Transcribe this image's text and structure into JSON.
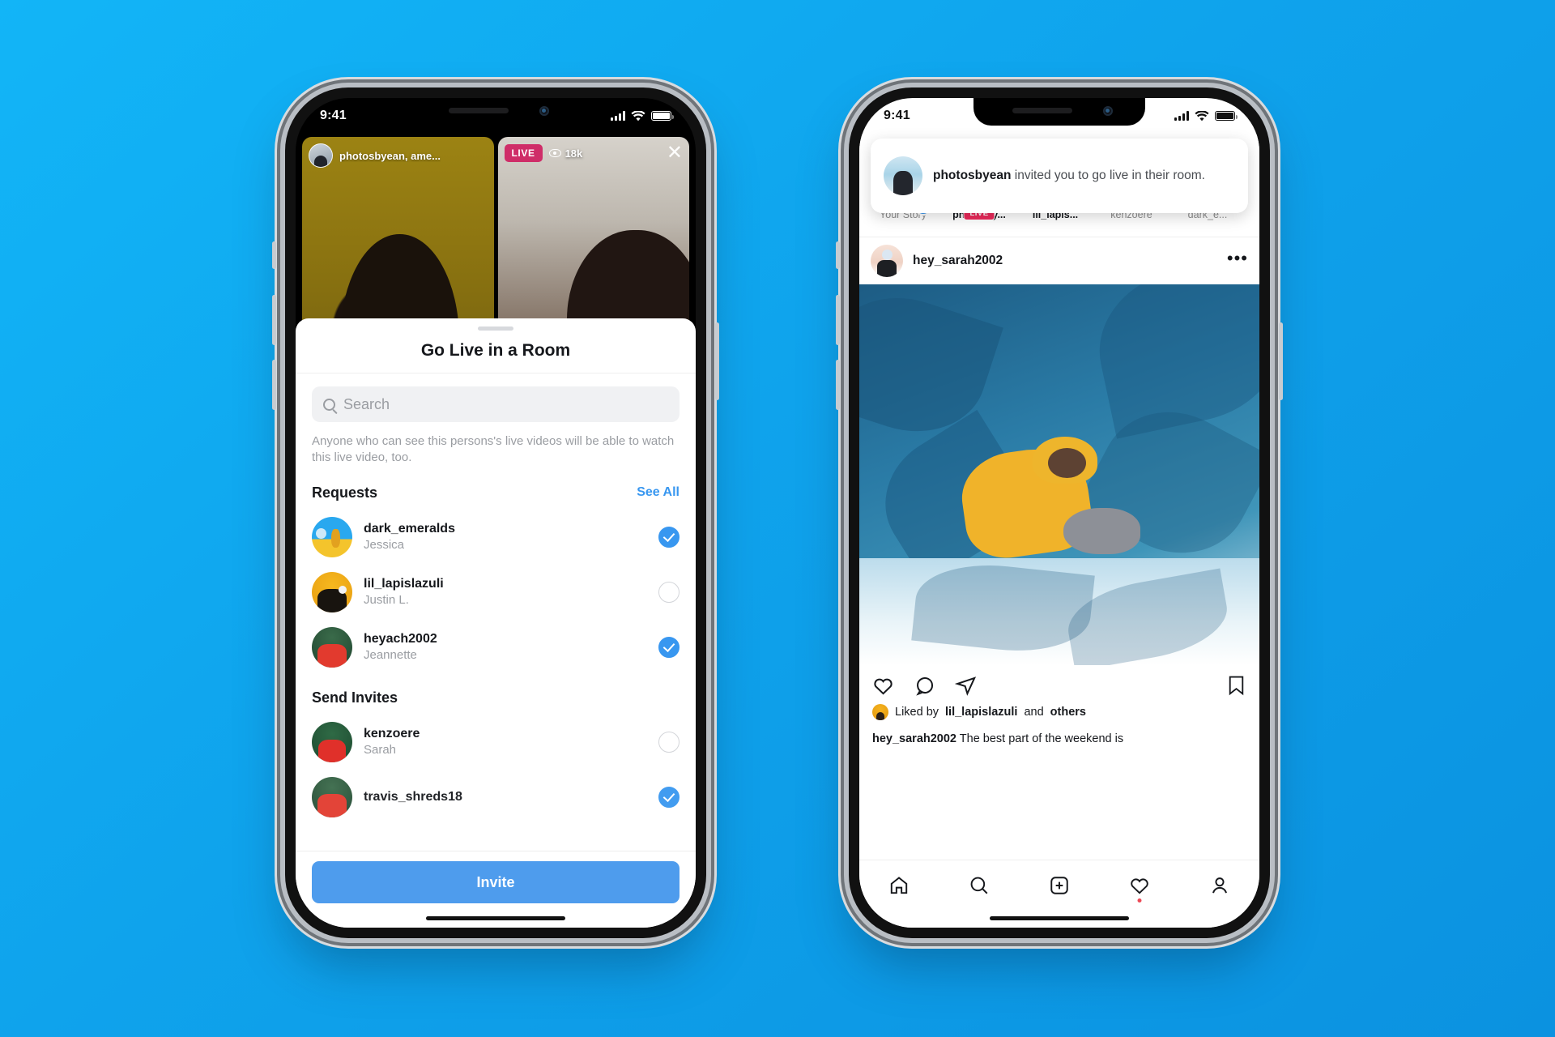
{
  "theme": {
    "background": "#0fa9f0",
    "accent": "#3897f0",
    "live_red": "#ed2a5b",
    "cta_blue": "#4e9ced"
  },
  "phone1": {
    "status_bar": {
      "time": "9:41"
    },
    "live_grid": {
      "tile_left": {
        "names": "photosbyean, ame..."
      },
      "tile_right": {
        "live_label": "LIVE",
        "viewers": "18k",
        "close_label": "✕"
      }
    },
    "sheet": {
      "title": "Go Live in a Room",
      "search_placeholder": "Search",
      "helper_text": "Anyone who can see this persons's live videos will be able to watch this live video, too.",
      "sections": [
        {
          "title": "Requests",
          "action_label": "See All",
          "people": [
            {
              "username": "dark_emeralds",
              "name": "Jessica",
              "selected": true,
              "avatar": "illustration-avatar"
            },
            {
              "username": "lil_lapislazuli",
              "name": "Justin L.",
              "selected": false,
              "avatar": "yellow-avatar"
            },
            {
              "username": "heyach2002",
              "name": "Jeannette",
              "selected": true,
              "avatar": "red-avatar"
            }
          ]
        },
        {
          "title": "Send Invites",
          "action_label": "",
          "people": [
            {
              "username": "kenzoere",
              "name": "Sarah",
              "selected": false,
              "avatar": "green-avatar"
            },
            {
              "username": "travis_shreds18",
              "name": "",
              "selected": true,
              "avatar": "red-avatar"
            }
          ]
        }
      ],
      "cta_label": "Invite"
    }
  },
  "phone2": {
    "status_bar": {
      "time": "9:41"
    },
    "notification": {
      "actor": "photosbyean",
      "message": " invited you to go live in their room."
    },
    "stories": [
      {
        "label": "Your Story",
        "ring": "none",
        "badge": "plus",
        "avatar": "dark-avatar"
      },
      {
        "label": "photosby...",
        "ring": "grad",
        "badge": "live",
        "live_label": "LIVE",
        "avatar": "beach-avatar"
      },
      {
        "label": "lil_lapis...",
        "ring": "grad",
        "badge": "",
        "avatar": "yellow-avatar"
      },
      {
        "label": "kenzoere",
        "ring": "plain",
        "badge": "",
        "avatar": "green-avatar"
      },
      {
        "label": "dark_e...",
        "ring": "plain",
        "badge": "",
        "avatar": "illustration-avatar"
      }
    ],
    "post": {
      "username": "hey_sarah2002",
      "more_label": "•••",
      "likes_text_prefix": "Liked by ",
      "likes_user": "lil_lapislazuli",
      "likes_text_mid": " and ",
      "likes_text_suffix": "others",
      "caption_user": "hey_sarah2002",
      "caption_text": " The best part of the weekend is"
    },
    "tabbar": [
      {
        "name": "home",
        "active": true
      },
      {
        "name": "search",
        "active": false
      },
      {
        "name": "create",
        "active": false
      },
      {
        "name": "activity",
        "active": false,
        "badge": true
      },
      {
        "name": "profile",
        "active": false
      }
    ]
  }
}
